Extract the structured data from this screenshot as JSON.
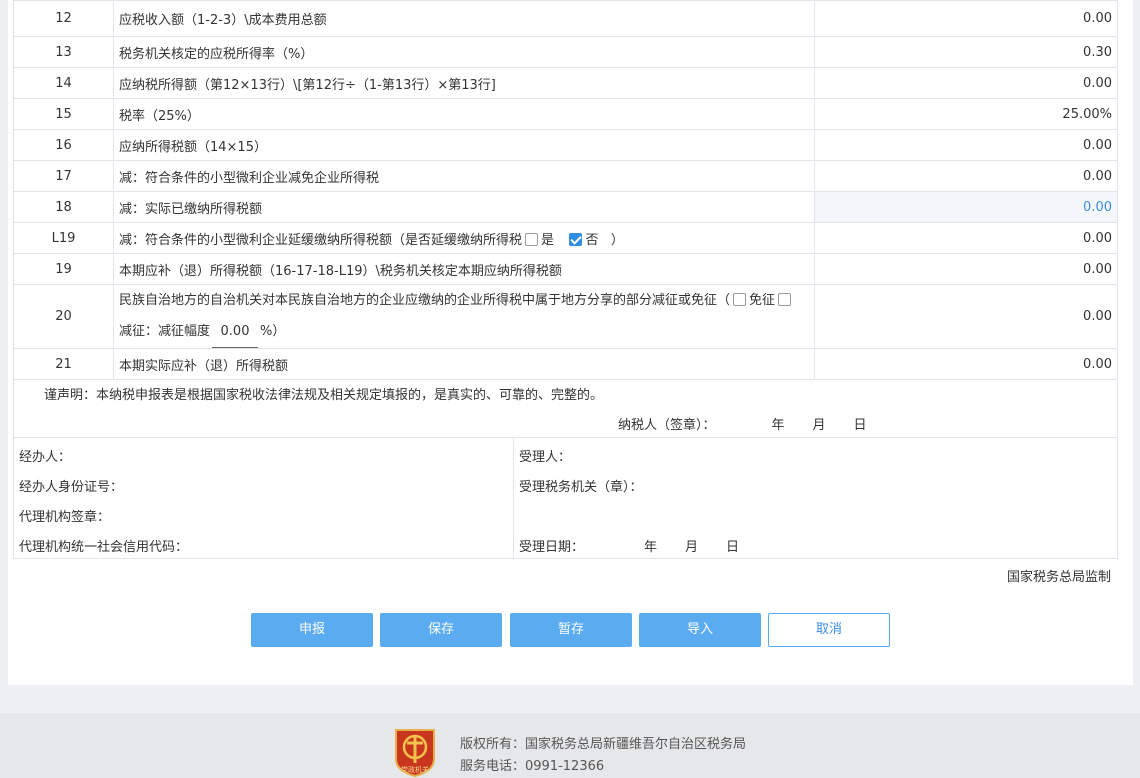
{
  "rows": [
    {
      "no": "12",
      "desc": "应税收入额（1-2-3）\\成本费用总额",
      "val": "0.00"
    },
    {
      "no": "13",
      "desc": "税务机关核定的应税所得率（%）",
      "val": "0.30"
    },
    {
      "no": "14",
      "desc": "应纳税所得额（第12×13行）\\[第12行÷（1-第13行）×第13行]",
      "val": "0.00"
    },
    {
      "no": "15",
      "desc": "税率（25%）",
      "val": "25.00%"
    },
    {
      "no": "16",
      "desc": "应纳所得税额（14×15）",
      "val": "0.00"
    },
    {
      "no": "17",
      "desc": "减：符合条件的小型微利企业减免企业所得税",
      "val": "0.00"
    },
    {
      "no": "18",
      "desc": "减：实际已缴纳所得税额",
      "val": "0.00"
    },
    {
      "no": "L19",
      "desc": "减：符合条件的小型微利企业延缓缴纳所得税额（是否延缓缴纳所得税",
      "opt_yes": "是",
      "opt_no": "否",
      "close": "）",
      "val": "0.00"
    },
    {
      "no": "19",
      "desc": "本期应补（退）所得税额（16-17-18-L19）\\税务机关核定本期应纳所得税额",
      "val": "0.00"
    },
    {
      "no": "20",
      "desc": "民族自治地方的自治机关对本民族自治地方的企业应缴纳的企业所得税中属于地方分享的部分减征或免征（",
      "exempt": "免征",
      "reduce_label": "减征：减征幅度",
      "rate": "0.00",
      "pct": "%）",
      "val": "0.00"
    },
    {
      "no": "21",
      "desc": "本期实际应补（退）所得税额",
      "val": "0.00"
    }
  ],
  "declaration": {
    "statement": "谨声明：本纳税申报表是根据国家税收法律法规及相关规定填报的，是真实的、可靠的、完整的。",
    "taxpayer_sign": "纳税人（签章）：",
    "year": "年",
    "month": "月",
    "day": "日"
  },
  "signatures": {
    "handler": "经办人：",
    "handler_id": "经办人身份证号：",
    "agency_seal": "代理机构签章：",
    "agency_code": "代理机构统一社会信用代码：",
    "receiver": "受理人：",
    "receiving_office": "受理税务机关（章）：",
    "receive_date": "受理日期：",
    "year": "年",
    "month": "月",
    "day": "日"
  },
  "supervise": "国家税务总局监制",
  "buttons": {
    "submit": "申报",
    "save": "保存",
    "draft": "暂存",
    "import": "导入",
    "cancel": "取消"
  },
  "footer": {
    "copyright": "版权所有：国家税务总局新疆维吾尔自治区税务局",
    "phone": "服务电话：0991-12366",
    "logo_text": "党政机关"
  },
  "colors": {
    "primary": "#5aabf0",
    "checked": "#2f8fe0",
    "edit_bg": "#f3f7fc"
  }
}
